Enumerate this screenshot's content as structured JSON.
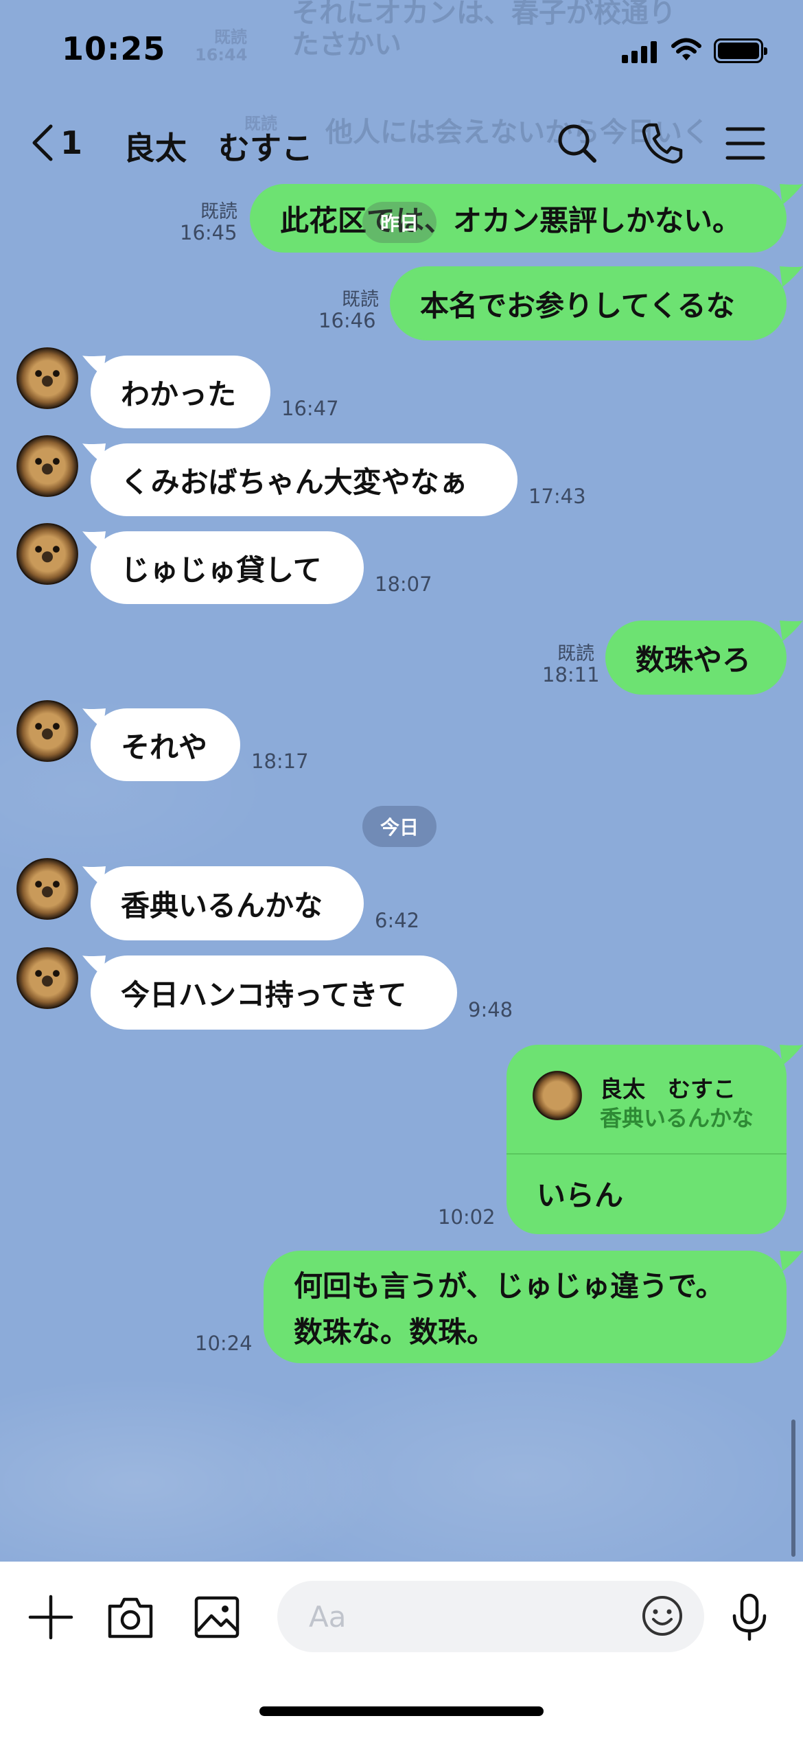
{
  "status": {
    "time": "10:25"
  },
  "header": {
    "back_count": "1",
    "title": "良太　むすこ"
  },
  "ghost": {
    "line1": "それにオカンは、春子が校通り",
    "line2": "たさかい",
    "read1": "既読",
    "time1": "16:44",
    "read2": "既読",
    "line3": "他人には会えないから今日いく"
  },
  "date_chips": {
    "yesterday": "昨日",
    "today": "今日"
  },
  "messages": [
    {
      "side": "out",
      "text": "此花区では、オカン悪評しかない。",
      "read": "既読",
      "time": "16:45"
    },
    {
      "side": "out",
      "text": "本名でお参りしてくるな",
      "read": "既読",
      "time": "16:46"
    },
    {
      "side": "in",
      "text": "わかった",
      "time": "16:47"
    },
    {
      "side": "in",
      "text": "くみおばちゃん大変やなぁ",
      "time": "17:43"
    },
    {
      "side": "in",
      "text": "じゅじゅ貸して",
      "time": "18:07"
    },
    {
      "side": "out",
      "text": "数珠やろ",
      "read": "既読",
      "time": "18:11"
    },
    {
      "side": "in",
      "text": "それや",
      "time": "18:17"
    },
    {
      "side": "in",
      "text": "香典いるんかな",
      "time": "6:42"
    },
    {
      "side": "in",
      "text": "今日ハンコ持ってきて",
      "time": "9:48"
    },
    {
      "side": "out",
      "reply_to_name": "良太　むすこ",
      "reply_to_text": "香典いるんかな",
      "text": "いらん",
      "time": "10:02"
    },
    {
      "side": "out",
      "text_line1": "何回も言うが、じゅじゅ違うで。",
      "text_line2": "数珠な。数珠。",
      "time": "10:24"
    }
  ],
  "composer": {
    "placeholder": "Aa"
  },
  "icons": {
    "back": "chevron-left-icon",
    "search": "search-icon",
    "call": "phone-icon",
    "menu": "menu-icon",
    "add": "plus-icon",
    "camera": "camera-icon",
    "image": "image-icon",
    "emoji": "emoji-icon",
    "mic": "microphone-icon"
  }
}
